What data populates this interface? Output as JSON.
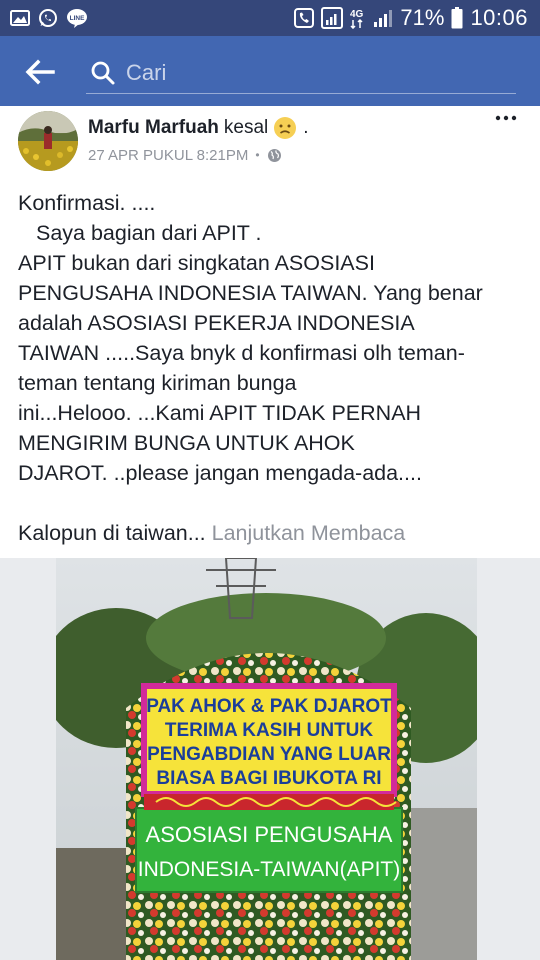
{
  "status_bar": {
    "battery_percent": "71%",
    "time": "10:06",
    "network": "4G",
    "icons": [
      "gallery-icon",
      "whatsapp-icon",
      "line-icon",
      "phone-data-icon",
      "signal-icon",
      "network-4g-icon",
      "signal-bars-icon",
      "battery-icon"
    ]
  },
  "app_bar": {
    "search_placeholder": "Cari",
    "back_icon": "arrow-left-icon",
    "search_icon": "search-icon",
    "color": "#4267b2"
  },
  "post": {
    "author": "Marfu Marfuah",
    "feeling": "kesal",
    "feeling_emoji": "sad-face-icon",
    "trailing": ".",
    "timestamp": "27 APR PUKUL 8:21PM",
    "separator": "•",
    "privacy_icon": "globe-icon",
    "more_icon": "more-dots-icon",
    "lines": [
      "Konfirmasi. ....",
      "Saya bagian dari APIT .",
      "APIT bukan dari singkatan ASOSIASI",
      "PENGUSAHA INDONESIA TAIWAN. Yang benar",
      "adalah ASOSIASI PEKERJA INDONESIA",
      "TAIWAN .....Saya bnyk d konfirmasi olh teman-",
      "teman tentang kiriman bunga",
      "ini...Helooo. ...Kami APIT TIDAK PERNAH",
      "MENGIRIM BUNGA UNTUK AHOK",
      "DJAROT. ..please jangan mengada-ada...."
    ],
    "last_line": "Kalopun di taiwan...",
    "see_more": "Lanjutkan Membaca"
  },
  "photo": {
    "banner_lines": [
      "PAK AHOK & PAK DJAROT",
      "TERIMA KASIH UNTUK",
      "PENGABDIAN YANG LUAR",
      "BIASA BAGI IBUKOTA RI"
    ],
    "sender_lines": [
      "ASOSIASI PENGUSAHA",
      "INDONESIA-TAIWAN(APIT)"
    ]
  }
}
